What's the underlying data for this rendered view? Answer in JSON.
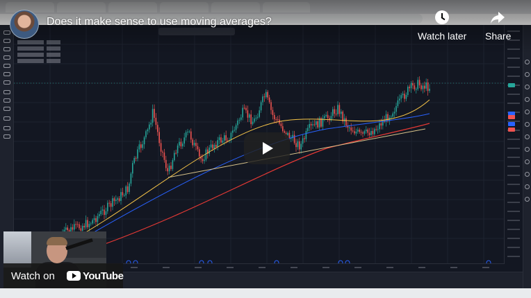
{
  "video": {
    "title": "Does it make sense to use moving averages?",
    "watch_later_label": "Watch later",
    "share_label": "Share",
    "watch_on_label": "Watch on",
    "brand_label": "YouTube"
  },
  "icons": {
    "avatar": "channel-avatar",
    "watch_later": "clock-icon",
    "share": "share-arrow-icon",
    "play": "play-icon",
    "brand": "youtube-logo-icon"
  },
  "colors": {
    "candle_up": "#26a69a",
    "candle_down": "#ef5350",
    "ma_fast": "#f7c548",
    "ma_mid": "#2962ff",
    "ma_slow": "#e53935",
    "trendline": "#d9c48b",
    "background": "#131722"
  }
}
